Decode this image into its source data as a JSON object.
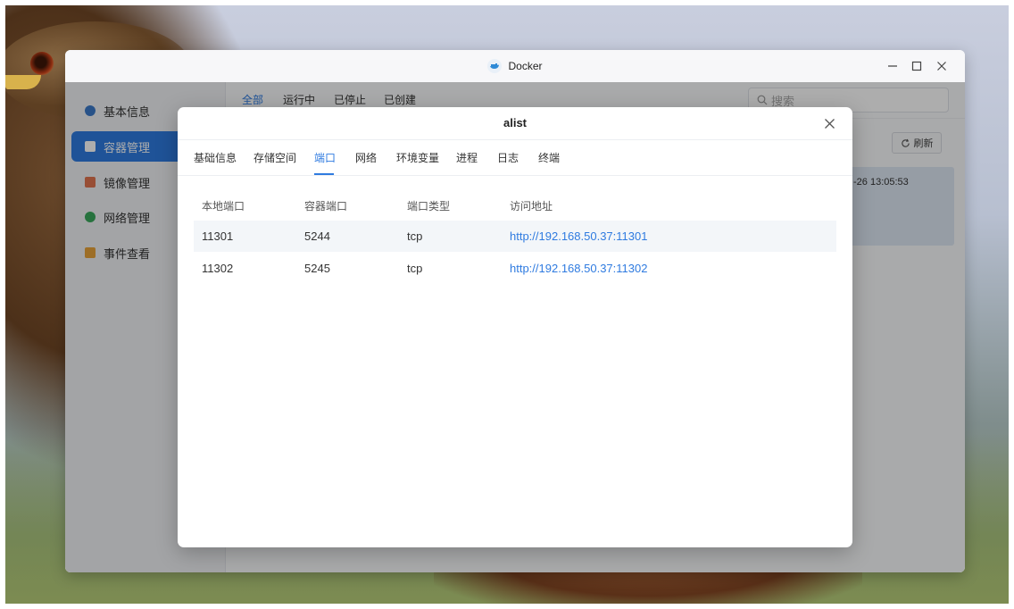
{
  "window": {
    "title": "Docker",
    "minimize_icon": "minimize-icon",
    "maximize_icon": "maximize-icon",
    "close_icon": "close-icon"
  },
  "sidebar": {
    "items": [
      {
        "label": "基本信息",
        "icon": "docker-icon",
        "active": false
      },
      {
        "label": "容器管理",
        "icon": "container-icon",
        "active": true
      },
      {
        "label": "镜像管理",
        "icon": "image-icon",
        "active": false
      },
      {
        "label": "网络管理",
        "icon": "globe-icon",
        "active": false
      },
      {
        "label": "事件查看",
        "icon": "calendar-icon",
        "active": false
      }
    ]
  },
  "main": {
    "filters": [
      "全部",
      "运行中",
      "已停止",
      "已创建"
    ],
    "search_placeholder": "搜索",
    "refresh_label": "刷新",
    "card_time_fragment": "-26 13:05:53"
  },
  "dialog": {
    "title": "alist",
    "tabs": [
      "基础信息",
      "存储空间",
      "端口",
      "网络",
      "环境变量",
      "进程",
      "日志",
      "终端"
    ],
    "active_tab": "端口",
    "columns": [
      "本地端口",
      "容器端口",
      "端口类型",
      "访问地址"
    ],
    "rows": [
      {
        "local": "11301",
        "container": "5244",
        "type": "tcp",
        "url": "http://192.168.50.37:11301"
      },
      {
        "local": "11302",
        "container": "5245",
        "type": "tcp",
        "url": "http://192.168.50.37:11302"
      }
    ]
  },
  "colors": {
    "accent": "#2f7be0",
    "sidebar_active": "#2f7be0",
    "table_alt_row": "#f3f6f9"
  }
}
